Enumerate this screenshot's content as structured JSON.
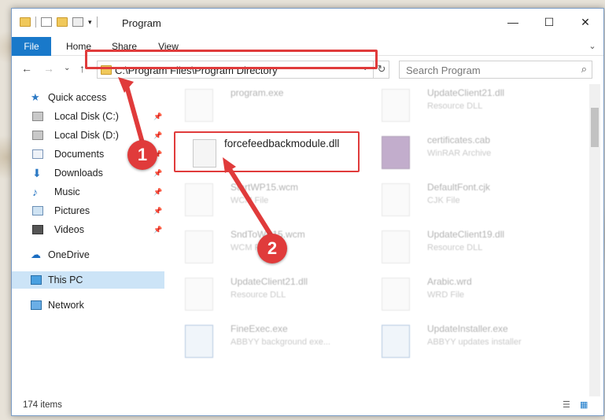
{
  "window": {
    "title": "Program"
  },
  "ribbon": {
    "tabs": [
      "File",
      "Home",
      "Share",
      "View"
    ]
  },
  "nav": {
    "back": "←",
    "forward": "→",
    "recent": "⌄",
    "up": "↑"
  },
  "address": {
    "path": "C:\\Program Files\\Program Directory",
    "refresh": "↻",
    "dropdown": "⌄"
  },
  "search": {
    "placeholder": "Search Program",
    "icon": "search-icon"
  },
  "sidebar": {
    "items": [
      {
        "label": "Quick access",
        "icon": "star-icon",
        "pinned": false
      },
      {
        "label": "Local Disk (C:)",
        "icon": "drive-icon",
        "pinned": true
      },
      {
        "label": "Local Disk (D:)",
        "icon": "drive-icon",
        "pinned": true
      },
      {
        "label": "Documents",
        "icon": "documents-icon",
        "pinned": true
      },
      {
        "label": "Downloads",
        "icon": "download-icon",
        "pinned": true
      },
      {
        "label": "Music",
        "icon": "music-icon",
        "pinned": true
      },
      {
        "label": "Pictures",
        "icon": "pictures-icon",
        "pinned": true
      },
      {
        "label": "Videos",
        "icon": "videos-icon",
        "pinned": true
      },
      {
        "label": "OneDrive",
        "icon": "cloud-icon",
        "pinned": false
      },
      {
        "label": "This PC",
        "icon": "pc-icon",
        "pinned": false
      },
      {
        "label": "Network",
        "icon": "network-icon",
        "pinned": false
      }
    ]
  },
  "files": [
    {
      "name": "program.exe",
      "sub": ""
    },
    {
      "name": "UpdateClient21.dll",
      "sub": "Resource DLL"
    },
    {
      "name": "forcefeedbackmodule.dll",
      "sub": ""
    },
    {
      "name": "certificates.cab",
      "sub": "WinRAR Archive"
    },
    {
      "name": "StartWP15.wcm",
      "sub": "WCM File"
    },
    {
      "name": "DefaultFont.cjk",
      "sub": "CJK File"
    },
    {
      "name": "SndToWP15.wcm",
      "sub": "WCM File"
    },
    {
      "name": "UpdateClient19.dll",
      "sub": "Resource DLL"
    },
    {
      "name": "UpdateClient21.dll",
      "sub": "Resource DLL"
    },
    {
      "name": "Arabic.wrd",
      "sub": "WRD File"
    },
    {
      "name": "FineExec.exe",
      "sub": "ABBYY background exe..."
    },
    {
      "name": "UpdateInstaller.exe",
      "sub": "ABBYY updates installer"
    }
  ],
  "status": {
    "count": "174 items"
  },
  "callouts": [
    "1",
    "2"
  ],
  "colors": {
    "accent": "#1979ca",
    "highlight": "#e03b3b",
    "selection": "#cce4f7"
  }
}
